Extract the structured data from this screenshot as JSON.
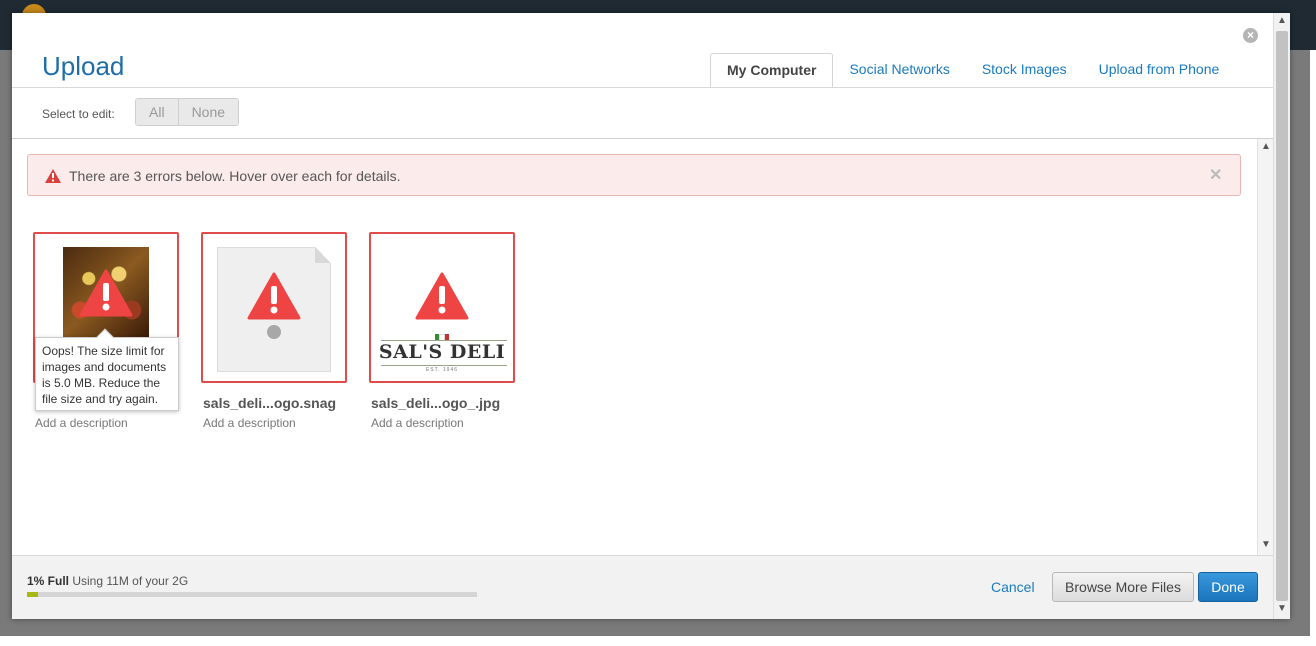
{
  "dialog": {
    "title": "Upload"
  },
  "tabs": [
    {
      "label": "My Computer",
      "active": true
    },
    {
      "label": "Social Networks",
      "active": false
    },
    {
      "label": "Stock Images",
      "active": false
    },
    {
      "label": "Upload from Phone",
      "active": false
    }
  ],
  "select": {
    "label": "Select to edit:",
    "all": "All",
    "none": "None"
  },
  "alert": {
    "text": "There are 3 errors below. Hover over each for details.",
    "icon": "warning-triangle-icon",
    "close_icon": "close-icon"
  },
  "files": [
    {
      "name": "",
      "description": "Add a description",
      "thumbnail": "photo",
      "status": "error"
    },
    {
      "name": "sals_deli...ogo.snag",
      "description": "Add a description",
      "thumbnail": "document",
      "status": "error"
    },
    {
      "name": "sals_deli...ogo_.jpg",
      "description": "Add a description",
      "thumbnail": "logo",
      "status": "error"
    }
  ],
  "logo": {
    "text": "SAL'S DELI",
    "est": "EST. 1946"
  },
  "tooltip": {
    "text": "Oops! The size limit for images and documents is 5.0 MB. Reduce the file size and try again."
  },
  "footer": {
    "usage_bold": "1% Full",
    "usage_text": " Using 11M of your 2G",
    "usage_percent": 1,
    "cancel": "Cancel",
    "browse": "Browse More Files",
    "done": "Done"
  },
  "colors": {
    "accent": "#1a7bc0",
    "error": "#e04b4b",
    "progress": "#a7b811",
    "primary_button": "#1b75bd"
  }
}
